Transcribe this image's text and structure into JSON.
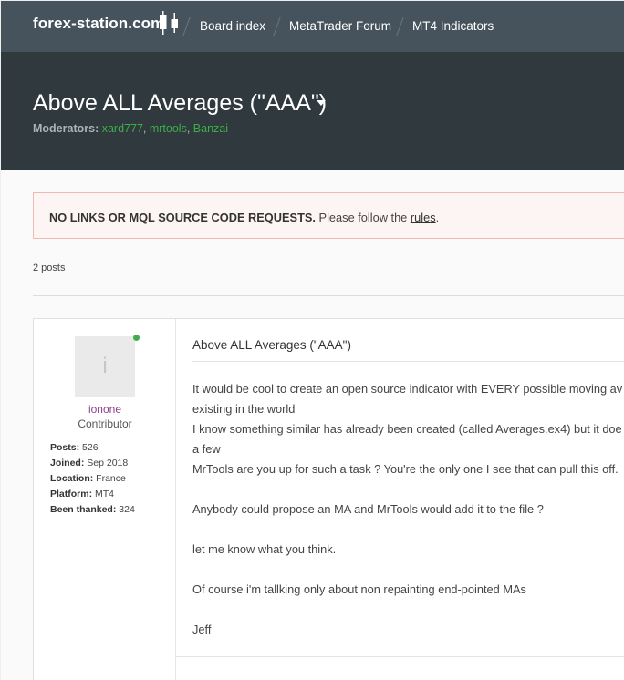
{
  "site": {
    "logo": "forex-station.com"
  },
  "breadcrumbs": [
    "Board index",
    "MetaTrader Forum",
    "MT4 Indicators"
  ],
  "forum": {
    "title": "Above ALL Averages (\"AAA\")",
    "moderators_label": "Moderators:",
    "moderators": [
      "xard777",
      "mrtools",
      "Banzai"
    ]
  },
  "notice": {
    "strong": "NO LINKS OR MQL SOURCE CODE REQUESTS.",
    "text": " Please follow the ",
    "link": "rules",
    "end": "."
  },
  "post_count": "2 posts",
  "post": {
    "author": {
      "avatar_letter": "i",
      "username": "ionone",
      "rank": "Contributor",
      "stats": [
        {
          "label": "Posts:",
          "value": "526"
        },
        {
          "label": "Joined:",
          "value": "Sep 2018"
        },
        {
          "label": "Location:",
          "value": "France"
        },
        {
          "label": "Platform:",
          "value": "MT4"
        },
        {
          "label": "Been thanked:",
          "value": "324"
        }
      ]
    },
    "title": "Above ALL Averages (\"AAA\")",
    "lines": [
      "It would be cool to create an open source indicator with EVERY possible moving av",
      "existing in the world",
      "I know something similar has already been created (called Averages.ex4) but it doe",
      "a few",
      "MrTools are you up for such a task ? You're the only one I see that can pull this off.",
      "",
      "Anybody could propose an MA and MrTools would add it to the file ?",
      "",
      "let me know what you think.",
      "",
      "Of course i'm tallking only about non repainting end-pointed MAs",
      "",
      "Jeff"
    ]
  },
  "colors": {
    "nav": "#46535c",
    "header": "#2f393e",
    "accent": "#3fae49",
    "username": "#8e3f8e"
  }
}
